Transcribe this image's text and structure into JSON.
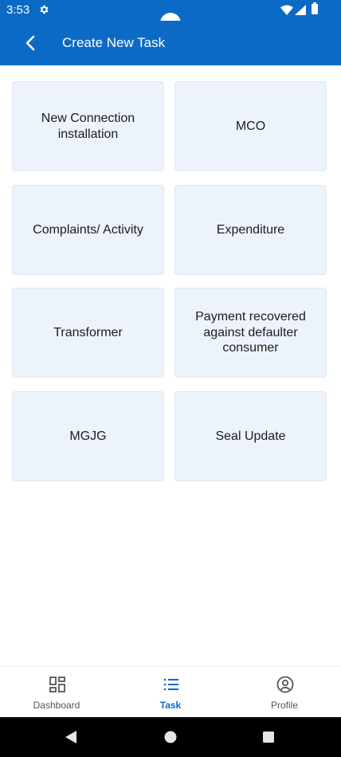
{
  "status": {
    "time": "3:53"
  },
  "header": {
    "title": "Create New Task"
  },
  "tasks": [
    {
      "label": "New Connection installation"
    },
    {
      "label": "MCO"
    },
    {
      "label": "Complaints/ Activity"
    },
    {
      "label": "Expenditure"
    },
    {
      "label": "Transformer"
    },
    {
      "label": "Payment recovered against defaulter consumer"
    },
    {
      "label": "MGJG"
    },
    {
      "label": "Seal Update"
    }
  ],
  "nav": {
    "items": [
      {
        "label": "Dashboard",
        "icon": "dashboard-icon"
      },
      {
        "label": "Task",
        "icon": "task-list-icon"
      },
      {
        "label": "Profile",
        "icon": "profile-icon"
      }
    ],
    "active": "Task",
    "active_color": "#0b6ac5"
  },
  "colors": {
    "primary": "#0b6ac5",
    "card": "#edf3fb"
  }
}
